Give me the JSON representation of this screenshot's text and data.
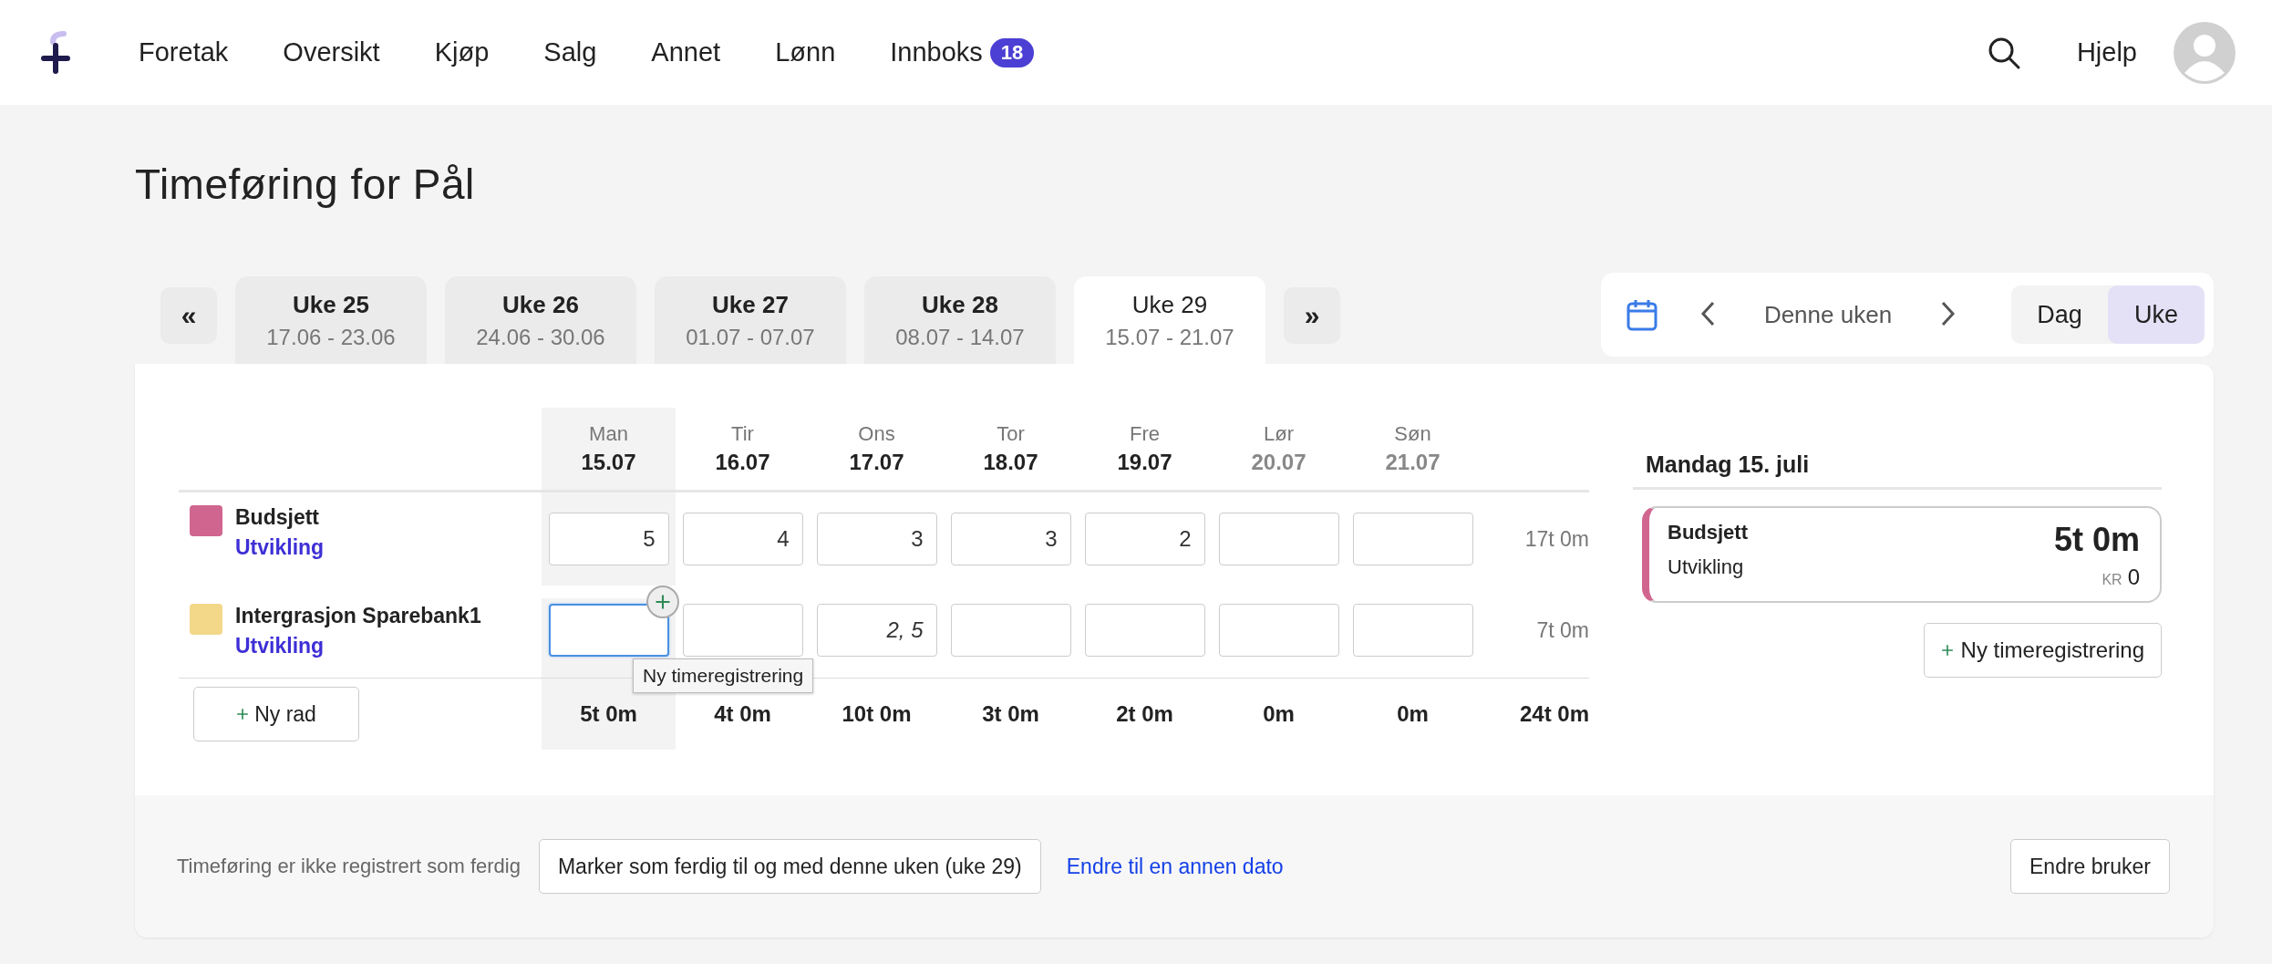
{
  "nav": {
    "items": [
      {
        "label": "Foretak"
      },
      {
        "label": "Oversikt"
      },
      {
        "label": "Kjøp"
      },
      {
        "label": "Salg"
      },
      {
        "label": "Annet"
      },
      {
        "label": "Lønn"
      },
      {
        "label": "Innboks",
        "badge": "18"
      }
    ],
    "help": "Hjelp"
  },
  "title": "Timeføring for Pål",
  "prev_week": "«",
  "next_week": "»",
  "weeks": [
    {
      "label": "Uke 25",
      "range": "17.06 - 23.06",
      "selected": false
    },
    {
      "label": "Uke 26",
      "range": "24.06 - 30.06",
      "selected": false
    },
    {
      "label": "Uke 27",
      "range": "01.07 - 07.07",
      "selected": false
    },
    {
      "label": "Uke 28",
      "range": "08.07 - 14.07",
      "selected": false
    },
    {
      "label": "Uke 29",
      "range": "15.07 - 21.07",
      "selected": true
    }
  ],
  "period": {
    "label": "Denne uken",
    "views": [
      {
        "label": "Dag",
        "selected": false
      },
      {
        "label": "Uke",
        "selected": true
      }
    ]
  },
  "grid": {
    "days": [
      {
        "name": "Man",
        "date": "15.07",
        "selected": true,
        "weekend": false
      },
      {
        "name": "Tir",
        "date": "16.07",
        "selected": false,
        "weekend": false
      },
      {
        "name": "Ons",
        "date": "17.07",
        "selected": false,
        "weekend": false
      },
      {
        "name": "Tor",
        "date": "18.07",
        "selected": false,
        "weekend": false
      },
      {
        "name": "Fre",
        "date": "19.07",
        "selected": false,
        "weekend": false
      },
      {
        "name": "Lør",
        "date": "20.07",
        "selected": false,
        "weekend": true
      },
      {
        "name": "Søn",
        "date": "21.07",
        "selected": false,
        "weekend": true
      }
    ],
    "rows": [
      {
        "name": "Budsjett",
        "activity": "Utvikling",
        "color": "#d0668f",
        "total": "17t 0m",
        "cells": [
          {
            "value": "5",
            "focused": false,
            "editing": false
          },
          {
            "value": "4",
            "focused": false,
            "editing": false
          },
          {
            "value": "3",
            "focused": false,
            "editing": false
          },
          {
            "value": "3",
            "focused": false,
            "editing": false
          },
          {
            "value": "2",
            "focused": false,
            "editing": false
          },
          {
            "focused": false
          },
          {
            "focused": false
          }
        ]
      },
      {
        "name": "Intergrasjon Sparebank1",
        "activity": "Utvikling",
        "color": "#f3d88a",
        "total": "7t 0m",
        "cells": [
          {
            "focused": true
          },
          {
            "focused": false
          },
          {
            "value": "2, 5",
            "focused": false,
            "editing": true
          },
          {
            "focused": false
          },
          {
            "focused": false
          },
          {
            "focused": false
          },
          {
            "focused": false
          }
        ]
      }
    ],
    "add_row": "Ny rad",
    "day_totals": [
      "5t 0m",
      "4t 0m",
      "10t 0m",
      "3t 0m",
      "2t 0m",
      "0m",
      "0m"
    ],
    "grand_total": "24t 0m",
    "tooltip": "Ny timeregistrering"
  },
  "day_panel": {
    "title": "Mandag 15. juli",
    "entries": [
      {
        "project": "Budsjett",
        "activity": "Utvikling",
        "color": "#d0668f",
        "duration": "5t 0m",
        "currency": "KR",
        "amount": "0"
      }
    ],
    "new_button": "Ny timeregistrering"
  },
  "footer": {
    "status": "Timeføring er ikke registrert som ferdig",
    "mark_done": "Marker som ferdig til og med denne uken (uke 29)",
    "change_date": "Endre til en annen dato",
    "change_user": "Endre bruker"
  }
}
